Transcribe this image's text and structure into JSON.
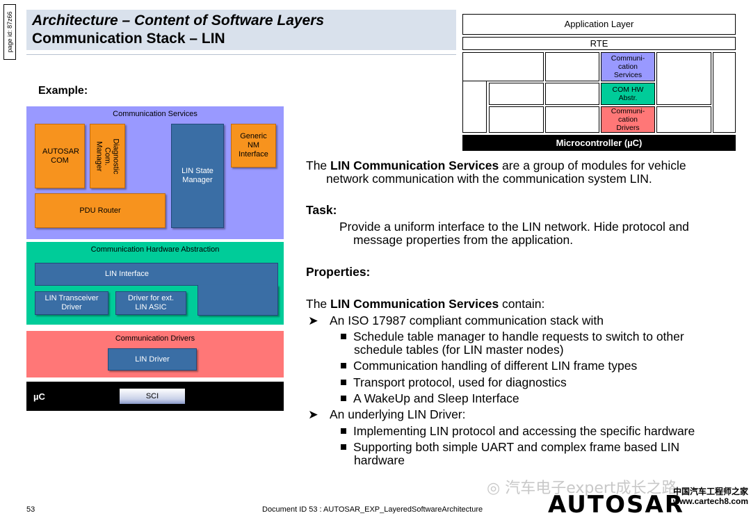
{
  "page_id": "page id: 87z66",
  "title": {
    "line1": "Architecture – Content of Software Layers",
    "line2": "Communication Stack – LIN"
  },
  "example_label": "Example:",
  "diagram": {
    "comm_services": {
      "label": "Communication Services",
      "autosar_com": "AUTOSAR COM",
      "dcm": "Diagnostic Com. Manager",
      "generic_nm": "Generic NM Interface",
      "lin_state_manager": "LIN State Manager",
      "pdu_router": "PDU Router"
    },
    "comm_hw_abstraction": {
      "label": "Communication Hardware Abstraction",
      "lin_interface": "LIN Interface",
      "lin_transceiver": "LIN Transceiver Driver",
      "driver_ext": "Driver for ext. LIN ASIC"
    },
    "comm_drivers": {
      "label": "Communication Drivers",
      "lin_driver": "LIN Driver"
    },
    "uc": {
      "label": "µC",
      "sci": "SCI"
    }
  },
  "mini_arch": {
    "application_layer": "Application Layer",
    "rte": "RTE",
    "comm_services": "Communi-cation Services",
    "com_hw_abstr": "COM HW Abstr.",
    "comm_drivers": "Communi-cation Drivers",
    "microcontroller": "Microcontroller (µC)",
    "colors": {
      "services": "#9999ff",
      "hw_abstr": "#00cc99",
      "drivers": "#ff7777"
    }
  },
  "content": {
    "intro_pre": "The ",
    "intro_bold": "LIN Communication Services",
    "intro_post_1": " are a group of modules for vehicle",
    "intro_post_2": "network communication with the communication system LIN.",
    "task_heading": "Task:",
    "task_line1": "Provide a uniform interface to the LIN network. Hide protocol and",
    "task_line2": "message properties from the application.",
    "properties_heading": "Properties:",
    "contain_pre": "The ",
    "contain_bold": "LIN Communication Services",
    "contain_post": " contain:",
    "item1": "An ISO 17987 compliant communication stack with",
    "sub1_line1": "Schedule table manager to handle requests to switch to other",
    "sub1_line2": "schedule tables (for LIN master nodes)",
    "sub2": "Communication handling of different LIN frame types",
    "sub3": "Transport protocol, used for diagnostics",
    "sub4": "A WakeUp and Sleep Interface",
    "item2": "An underlying LIN Driver:",
    "sub5": "Implementing LIN protocol and accessing the specific hardware",
    "sub6_line1": "Supporting both simple UART and complex frame based LIN",
    "sub6_line2": "hardware"
  },
  "footer": {
    "page_number": "53",
    "document_id": "Document ID 53 : AUTOSAR_EXP_LayeredSoftwareArchitecture",
    "logo": "AUTOSAR",
    "watermark": "汽车电子expert成长之路",
    "watermark_site": "中国汽车工程师之家 www.cartech8.com"
  }
}
